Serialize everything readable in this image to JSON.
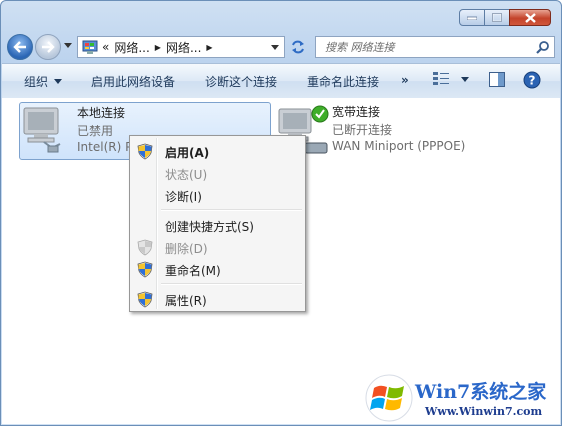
{
  "window": {
    "caption_buttons": [
      "minimize",
      "maximize",
      "close"
    ]
  },
  "address": {
    "prefix": "«",
    "crumbs": [
      "网络...",
      "网络..."
    ],
    "search_placeholder": "搜索 网络连接"
  },
  "toolbar": {
    "organize": "组织",
    "enable": "启用此网络设备",
    "diagnose": "诊断这个连接",
    "rename": "重命名此连接",
    "more": "»"
  },
  "connections": [
    {
      "name": "本地连接",
      "status": "已禁用",
      "device": "Intel(R) P"
    },
    {
      "name": "宽带连接",
      "status": "已断开连接",
      "device": "WAN Miniport (PPPOE)"
    }
  ],
  "menu": {
    "enable": "启用(A)",
    "status": "状态(U)",
    "diagnose": "诊断(I)",
    "shortcut": "创建快捷方式(S)",
    "delete": "删除(D)",
    "rename": "重命名(M)",
    "properties": "属性(R)"
  },
  "watermark": {
    "brand": "Win7系统之家",
    "url": "Www.Winwin7.com"
  },
  "colors": {
    "accent": "#2a67c9",
    "selection": "#cfe3fb",
    "check_green": "#3fae2a"
  }
}
